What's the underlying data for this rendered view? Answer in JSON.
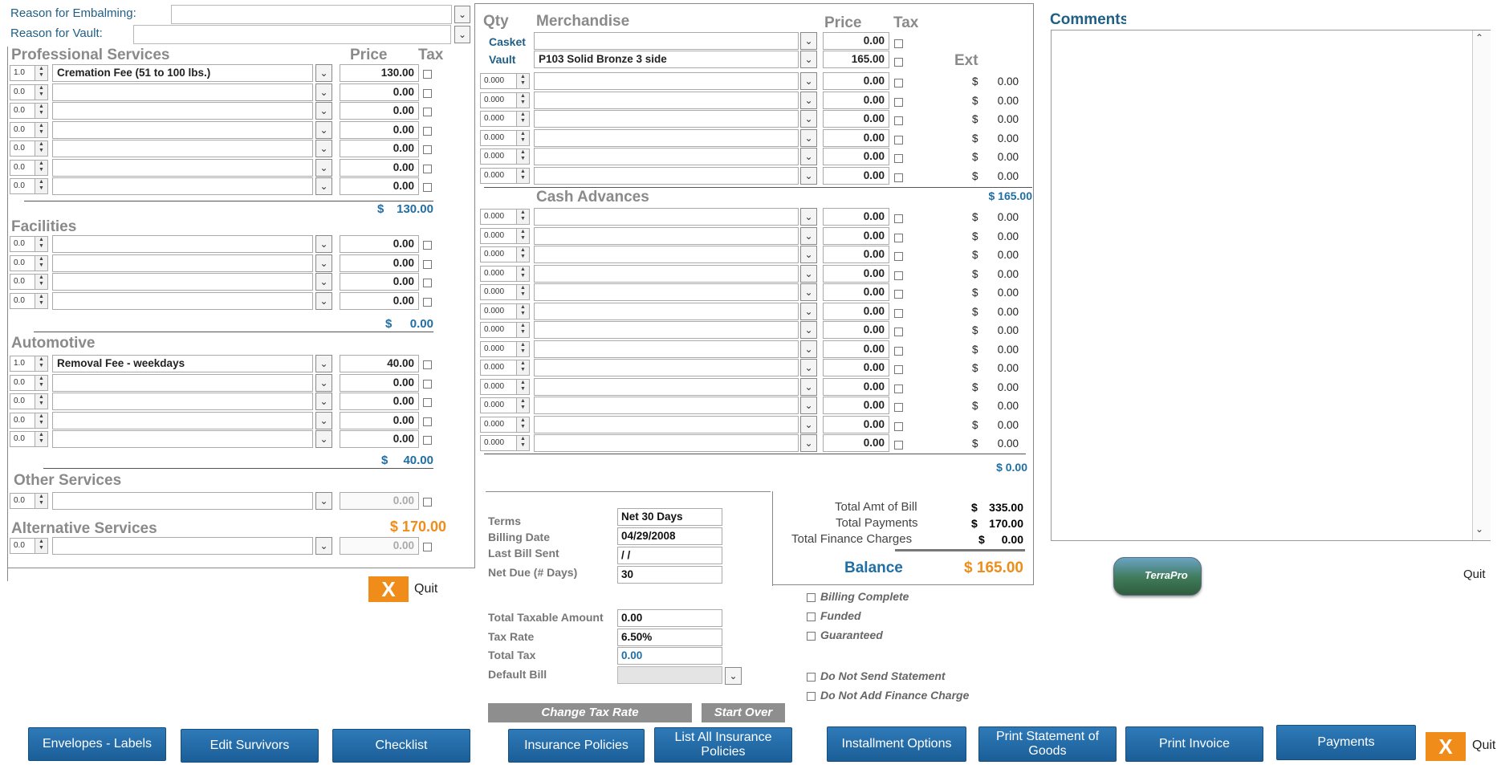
{
  "header": {
    "reason_embalming_label": "Reason for Embalming:",
    "reason_vault_label": "Reason for Vault:"
  },
  "left": {
    "price_header": "Price",
    "tax_header": "Tax",
    "professional": {
      "title": "Professional Services",
      "rows": [
        {
          "qty": "1.0",
          "desc": "Cremation Fee (51 to 100 lbs.)",
          "price": "130.00"
        },
        {
          "qty": "0.0",
          "desc": "",
          "price": "0.00"
        },
        {
          "qty": "0.0",
          "desc": "",
          "price": "0.00"
        },
        {
          "qty": "0.0",
          "desc": "",
          "price": "0.00"
        },
        {
          "qty": "0.0",
          "desc": "",
          "price": "0.00"
        },
        {
          "qty": "0.0",
          "desc": "",
          "price": "0.00"
        },
        {
          "qty": "0.0",
          "desc": "",
          "price": "0.00"
        }
      ],
      "total_dollar": "$",
      "total": "130.00"
    },
    "facilities": {
      "title": "Facilities",
      "rows": [
        {
          "qty": "0.0",
          "desc": "",
          "price": "0.00"
        },
        {
          "qty": "0.0",
          "desc": "",
          "price": "0.00"
        },
        {
          "qty": "0.0",
          "desc": "",
          "price": "0.00"
        },
        {
          "qty": "0.0",
          "desc": "",
          "price": "0.00"
        }
      ],
      "total_dollar": "$",
      "total": "0.00"
    },
    "automotive": {
      "title": "Automotive",
      "rows": [
        {
          "qty": "1.0",
          "desc": "Removal Fee - weekdays",
          "price": "40.00"
        },
        {
          "qty": "0.0",
          "desc": "",
          "price": "0.00"
        },
        {
          "qty": "0.0",
          "desc": "",
          "price": "0.00"
        },
        {
          "qty": "0.0",
          "desc": "",
          "price": "0.00"
        },
        {
          "qty": "0.0",
          "desc": "",
          "price": "0.00"
        }
      ],
      "total_dollar": "$",
      "total": "40.00"
    },
    "other": {
      "title": "Other Services",
      "rows": [
        {
          "qty": "0.0",
          "desc": "",
          "price": "0.00"
        }
      ]
    },
    "alternative": {
      "title": "Alternative Services",
      "total": "$ 170.00",
      "rows": [
        {
          "qty": "0.0",
          "desc": "",
          "price": "0.00"
        }
      ]
    },
    "quit_label": "Quit",
    "quit_x": "X"
  },
  "merch": {
    "qty_header": "Qty",
    "merch_header": "Merchandise",
    "price_header": "Price",
    "tax_header": "Tax",
    "ext_header": "Ext",
    "casket_label": "Casket",
    "casket_desc": "",
    "casket_price": "0.00",
    "vault_label": "Vault",
    "vault_desc": "P103 Solid Bronze 3 side",
    "vault_price": "165.00",
    "rows": [
      {
        "qty": "0.000",
        "price": "0.00",
        "ext_d": "$",
        "ext": "0.00"
      },
      {
        "qty": "0.000",
        "price": "0.00",
        "ext_d": "$",
        "ext": "0.00"
      },
      {
        "qty": "0.000",
        "price": "0.00",
        "ext_d": "$",
        "ext": "0.00"
      },
      {
        "qty": "0.000",
        "price": "0.00",
        "ext_d": "$",
        "ext": "0.00"
      },
      {
        "qty": "0.000",
        "price": "0.00",
        "ext_d": "$",
        "ext": "0.00"
      },
      {
        "qty": "0.000",
        "price": "0.00",
        "ext_d": "$",
        "ext": "0.00"
      }
    ],
    "total": "$   165.00"
  },
  "cash": {
    "title": "Cash Advances",
    "rows": [
      {
        "qty": "0.000",
        "price": "0.00",
        "ext_d": "$",
        "ext": "0.00"
      },
      {
        "qty": "0.000",
        "price": "0.00",
        "ext_d": "$",
        "ext": "0.00"
      },
      {
        "qty": "0.000",
        "price": "0.00",
        "ext_d": "$",
        "ext": "0.00"
      },
      {
        "qty": "0.000",
        "price": "0.00",
        "ext_d": "$",
        "ext": "0.00"
      },
      {
        "qty": "0.000",
        "price": "0.00",
        "ext_d": "$",
        "ext": "0.00"
      },
      {
        "qty": "0.000",
        "price": "0.00",
        "ext_d": "$",
        "ext": "0.00"
      },
      {
        "qty": "0.000",
        "price": "0.00",
        "ext_d": "$",
        "ext": "0.00"
      },
      {
        "qty": "0.000",
        "price": "0.00",
        "ext_d": "$",
        "ext": "0.00"
      },
      {
        "qty": "0.000",
        "price": "0.00",
        "ext_d": "$",
        "ext": "0.00"
      },
      {
        "qty": "0.000",
        "price": "0.00",
        "ext_d": "$",
        "ext": "0.00"
      },
      {
        "qty": "0.000",
        "price": "0.00",
        "ext_d": "$",
        "ext": "0.00"
      },
      {
        "qty": "0.000",
        "price": "0.00",
        "ext_d": "$",
        "ext": "0.00"
      },
      {
        "qty": "0.000",
        "price": "0.00",
        "ext_d": "$",
        "ext": "0.00"
      }
    ],
    "total": "$   0.00"
  },
  "billing": {
    "terms_label": "Terms",
    "terms": "Net 30 Days",
    "billing_date_label": "Billing Date",
    "billing_date": "04/29/2008",
    "last_bill_label": "Last Bill Sent",
    "last_bill": " /  /",
    "net_due_label": "Net Due (# Days)",
    "net_due": "30",
    "taxable_label": "Total Taxable Amount",
    "taxable": "0.00",
    "tax_rate_label": "Tax Rate",
    "tax_rate": "6.50%",
    "total_tax_label": "Total Tax",
    "total_tax": "0.00",
    "default_bill_label": "Default Bill",
    "change_tax_rate": "Change Tax Rate",
    "start_over": "Start Over"
  },
  "summary": {
    "amt_label": "Total Amt of Bill",
    "amt_d": "$",
    "amt": "335.00",
    "payments_label": "Total Payments",
    "payments_d": "$",
    "payments": "170.00",
    "finance_label": "Total Finance Charges",
    "finance_d": "$",
    "finance": "0.00",
    "balance_label": "Balance",
    "balance": "$   165.00"
  },
  "flags": {
    "billing_complete": "Billing Complete",
    "funded": "Funded",
    "guaranteed": "Guaranteed",
    "no_statement": "Do Not Send Statement",
    "no_finance": "Do Not Add Finance Charge"
  },
  "comments": {
    "title": "Comments",
    "logo_text": "TerraPro",
    "quit_label": "Quit"
  },
  "buttons": {
    "envelopes": "Envelopes - Labels",
    "edit_survivors": "Edit Survivors",
    "checklist": "Checklist",
    "insurance": "Insurance Policies",
    "list_insurance": "List All Insurance Policies",
    "installment": "Installment Options",
    "print_statement": "Print Statement of Goods",
    "print_invoice": "Print Invoice",
    "payments": "Payments",
    "quit_x": "X",
    "quit_label": "Quit"
  }
}
